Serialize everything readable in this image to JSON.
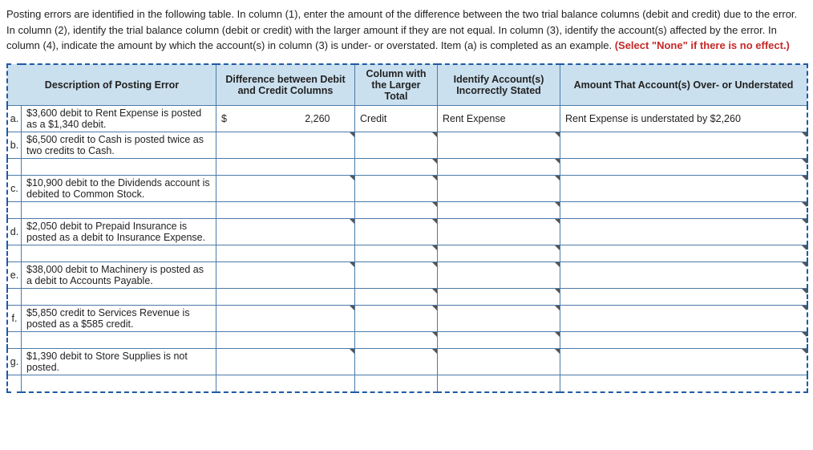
{
  "instructions": {
    "text": "Posting errors are identified in the following table. In column (1), enter the amount of the difference between the two trial balance columns (debit and credit) due to the error. In column (2), identify the trial balance column (debit or credit) with the larger amount if they are not equal. In column (3), identify the account(s) affected by the error. In column (4), indicate the amount by which the account(s) in column (3) is under- or overstated. Item (a) is completed as an example. ",
    "highlight": "(Select \"None\" if there is no effect.)"
  },
  "headers": {
    "desc": "Description of Posting Error",
    "diff": "Difference between Debit and Credit Columns",
    "col2": "Column with the Larger Total",
    "col3": "Identify Account(s) Incorrectly Stated",
    "col4": "Amount That Account(s) Over- or Understated"
  },
  "rows": {
    "a": {
      "letter": "a.",
      "desc": "$3,600 debit to Rent Expense is posted as a $1,340 debit.",
      "diff_symbol": "$",
      "diff_value": "2,260",
      "col2": "Credit",
      "col3": "Rent Expense",
      "col4": "Rent Expense is understated by $2,260"
    },
    "b": {
      "letter": "b.",
      "desc": "$6,500 credit to Cash is posted twice as two credits to Cash.",
      "diff_symbol": "",
      "diff_value": "",
      "col2": "",
      "col3": "",
      "col4": ""
    },
    "c": {
      "letter": "c.",
      "desc": "$10,900 debit to the Dividends account is debited to Common Stock.",
      "diff_symbol": "",
      "diff_value": "",
      "col2": "",
      "col3": "",
      "col4": ""
    },
    "d": {
      "letter": "d.",
      "desc": "$2,050 debit to Prepaid Insurance is posted as a debit to Insurance Expense.",
      "diff_symbol": "",
      "diff_value": "",
      "col2": "",
      "col3": "",
      "col4": ""
    },
    "e": {
      "letter": "e.",
      "desc": "$38,000 debit to Machinery is posted as a debit to Accounts Payable.",
      "diff_symbol": "",
      "diff_value": "",
      "col2": "",
      "col3": "",
      "col4": ""
    },
    "f": {
      "letter": "f.",
      "desc": "$5,850 credit to Services Revenue is posted as a $585 credit.",
      "diff_symbol": "",
      "diff_value": "",
      "col2": "",
      "col3": "",
      "col4": ""
    },
    "g": {
      "letter": "g.",
      "desc": "$1,390 debit to Store Supplies is not posted.",
      "diff_symbol": "",
      "diff_value": "",
      "col2": "",
      "col3": "",
      "col4": ""
    }
  }
}
